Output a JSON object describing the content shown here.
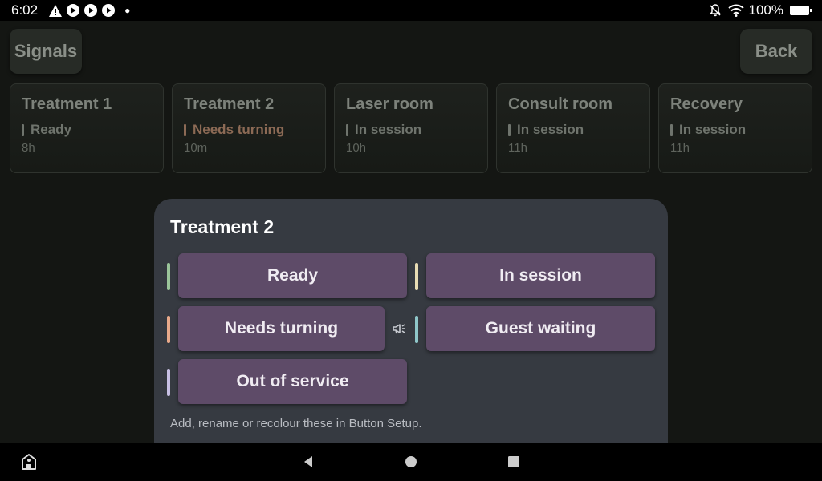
{
  "status_bar": {
    "time": "6:02",
    "battery": "100%",
    "left_icons": [
      "alert-icon",
      "play-icon",
      "play-icon",
      "play-icon"
    ],
    "right_icons": [
      "notifications-off-icon",
      "wifi-icon",
      "battery-icon"
    ]
  },
  "header": {
    "signals_label": "Signals",
    "back_label": "Back"
  },
  "rooms": [
    {
      "name": "Treatment 1",
      "status": "Ready",
      "time": "8h"
    },
    {
      "name": "Treatment 2",
      "status": "Needs turning",
      "time": "10m"
    },
    {
      "name": "Laser room",
      "status": "In session",
      "time": "10h"
    },
    {
      "name": "Consult room",
      "status": "In session",
      "time": "11h"
    },
    {
      "name": "Recovery",
      "status": "In session",
      "time": "11h"
    }
  ],
  "dialog": {
    "title": "Treatment 2",
    "buttons": [
      {
        "label": "Ready",
        "color": "#9bc59a"
      },
      {
        "label": "In session",
        "color": "#e8dcb4"
      },
      {
        "label": "Needs turning",
        "color": "#e8a98a"
      },
      {
        "label": "Guest waiting",
        "color": "#8fc6c9"
      },
      {
        "label": "Out of service",
        "color": "#c8c0e4"
      }
    ],
    "hint": "Add, rename or recolour these in Button Setup."
  },
  "colors": {
    "button_fill": "#5e4b68",
    "needs_turning_status": "#8c6a55"
  }
}
